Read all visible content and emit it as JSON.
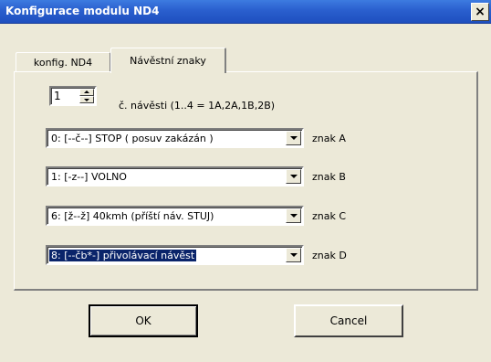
{
  "window": {
    "title": "Konfigurace modulu ND4",
    "close_glyph": "×"
  },
  "tabs": [
    {
      "label": "konfig. ND4"
    },
    {
      "label": "Návěstní znaky"
    }
  ],
  "spinner": {
    "value": "1",
    "label": "č. návěsti (1..4 = 1A,2A,1B,2B)"
  },
  "combos": [
    {
      "value": "0: [--č--] STOP   ( posuv zakázán )",
      "label": "znak A"
    },
    {
      "value": "1: [-z--] VOLNO",
      "label": "znak B"
    },
    {
      "value": "6: [ž--ž] 40kmh (příští náv. STUJ)",
      "label": "znak C"
    },
    {
      "value": "8: [--čb*-] přivolávací návěst",
      "label": "znak D"
    }
  ],
  "buttons": {
    "ok": "OK",
    "cancel": "Cancel"
  }
}
